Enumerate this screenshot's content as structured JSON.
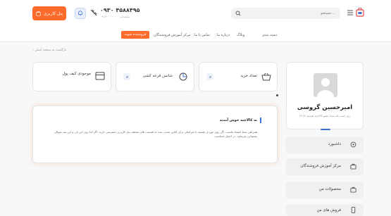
{
  "header": {
    "wallet_label": "پنل کاربری",
    "phone": "۰۹۳۰ ۴۵۸۸۴۹۵",
    "phone_sub": "۰۹۱۷-۰۰۰-۰۰۰۰ پشتیبانی",
    "search_placeholder": "جستجو...",
    "accent_color": "#ff6b2b"
  },
  "nav": {
    "items": [
      "دسته بندی",
      "وبلاگ",
      "درباره ما",
      "تماس با ما",
      "مرکز آموزش فروشندگان"
    ],
    "active": "فروشنده شوید"
  },
  "breadcrumb": "بازگشت به صفحه اصلی",
  "stats": {
    "purchases": "تعداد خرید",
    "discount": "شانس قرعه کشی",
    "wallet": "موجودی کیف پول"
  },
  "profile": {
    "name": "امیرحسین گروسی",
    "subtitle": "۲۲۸۳ روز است که شما عضو کالاچیه هستید"
  },
  "sidebar": {
    "items": [
      {
        "label": "داشبورد"
      },
      {
        "label": "مرکز آموزش فروشندگان"
      },
      {
        "label": "محصولات من"
      },
      {
        "label": "فروش های من"
      }
    ]
  },
  "welcome": {
    "title": "به کالاچیه خوش آمدید",
    "text": "همراهی شما اعتماد ماست. اگر روی موردی هستید یا شرایطی برای آنلاین شدن، بنده به قسمت های مختلف پنل کاربری دسترسی دارید. اگر اما روی این بار، و این شد سوالی پشتیبانی بفرمایید. در اختیار شماست."
  }
}
